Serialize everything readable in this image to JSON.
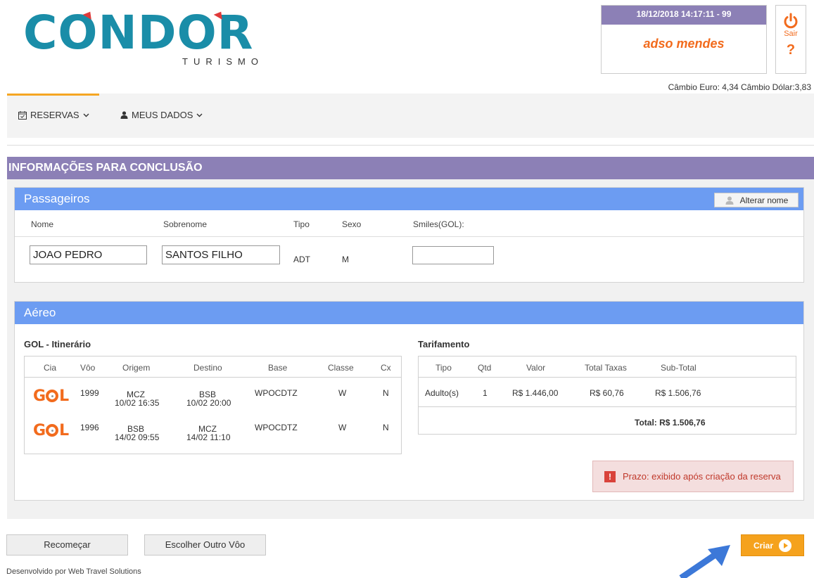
{
  "header": {
    "logo": {
      "main": "CONDOR",
      "sub": "TURISMO"
    },
    "datetime": "18/12/2018 14:17:11 - 99",
    "user_name": "adso mendes",
    "exit_label": "Sair",
    "help_label": "?",
    "exchange": "Câmbio Euro: 4,34   Câmbio Dólar:3,83"
  },
  "nav": {
    "items": [
      {
        "label": "RESERVAS",
        "icon": "calendar-check-icon",
        "active": true
      },
      {
        "label": "MEUS DADOS",
        "icon": "user-icon",
        "active": false
      }
    ]
  },
  "main": {
    "title": "INFORMAÇÕES PARA CONCLUSÃO",
    "passengers": {
      "title": "Passageiros",
      "alter_button": "Alterar nome",
      "columns": [
        "Nome",
        "Sobrenome",
        "Tipo",
        "Sexo",
        "Smiles(GOL):"
      ],
      "rows": [
        {
          "nome": "JOAO PEDRO",
          "sobrenome": "SANTOS FILHO",
          "tipo": "ADT",
          "sexo": "M",
          "smiles": ""
        }
      ]
    },
    "air": {
      "title": "Aéreo",
      "itinerary": {
        "title": "GOL - Itinerário",
        "columns": [
          "Cia",
          "Vôo",
          "Origem",
          "Destino",
          "Base",
          "Classe",
          "Cx"
        ],
        "rows": [
          {
            "cia": "GOL",
            "voo": "1999",
            "origem": "MCZ",
            "origem_dt": "10/02 16:35",
            "destino": "BSB",
            "destino_dt": "10/02 20:00",
            "base": "WPOCDTZ",
            "classe": "W",
            "cx": "N"
          },
          {
            "cia": "GOL",
            "voo": "1996",
            "origem": "BSB",
            "origem_dt": "14/02 09:55",
            "destino": "MCZ",
            "destino_dt": "14/02 11:10",
            "base": "WPOCDTZ",
            "classe": "W",
            "cx": "N"
          }
        ]
      },
      "fares": {
        "title": "Tarifamento",
        "columns": [
          "Tipo",
          "Qtd",
          "Valor",
          "Total Taxas",
          "Sub-Total"
        ],
        "rows": [
          {
            "tipo": "Adulto(s)",
            "qtd": "1",
            "valor": "R$ 1.446,00",
            "taxas": "R$ 60,76",
            "subtotal": "R$ 1.506,76"
          }
        ],
        "total": "Total: R$ 1.506,76"
      },
      "deadline": "Prazo: exibido após criação da reserva"
    }
  },
  "footer": {
    "restart_button": "Recomeçar",
    "other_flight_button": "Escolher Outro Vôo",
    "create_button": "Criar",
    "developer": "Desenvolvido por Web Travel Solutions"
  },
  "colors": {
    "accent_orange": "#f26b1d",
    "header_purple": "#8c80b6",
    "card_blue": "#6c9cf2",
    "logo_teal": "#1a8da8",
    "create_orange": "#f5a21d"
  }
}
